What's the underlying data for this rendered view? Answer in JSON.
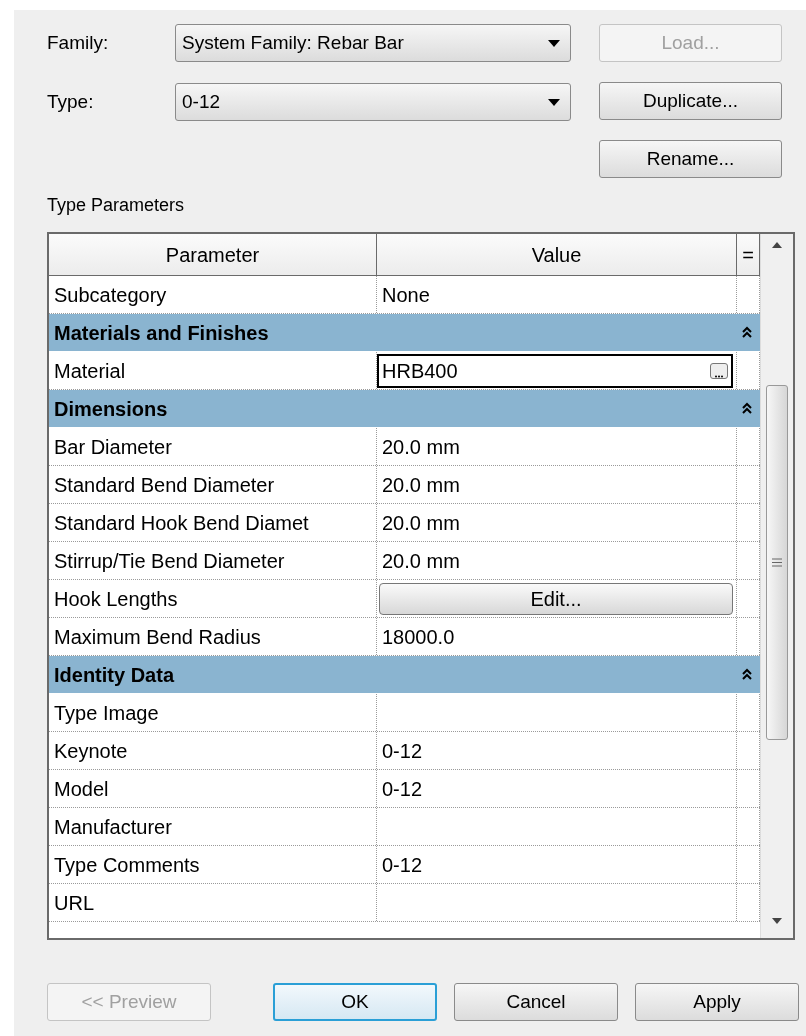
{
  "family": {
    "label": "Family:",
    "value": "System Family: Rebar Bar"
  },
  "type": {
    "label": "Type:",
    "value": "0-12"
  },
  "side_buttons": [
    {
      "label": "Load...",
      "disabled": true
    },
    {
      "label": "Duplicate...",
      "disabled": false
    },
    {
      "label": "Rename...",
      "disabled": false
    }
  ],
  "section_title": "Type Parameters",
  "table": {
    "columns": [
      "Parameter",
      "Value",
      "="
    ],
    "rows": [
      {
        "kind": "param",
        "name": "Subcategory",
        "value": "None"
      },
      {
        "kind": "group",
        "name": "Materials and Finishes",
        "expanded": true
      },
      {
        "kind": "field",
        "name": "Material",
        "value": "HRB400"
      },
      {
        "kind": "group",
        "name": "Dimensions",
        "expanded": true
      },
      {
        "kind": "param",
        "name": "Bar Diameter",
        "value": "20.0 mm"
      },
      {
        "kind": "param",
        "name": "Standard Bend Diameter",
        "value": "20.0 mm"
      },
      {
        "kind": "param",
        "name": "Standard Hook Bend Diamet",
        "value": "20.0 mm"
      },
      {
        "kind": "param",
        "name": "Stirrup/Tie Bend Diameter",
        "value": "20.0 mm"
      },
      {
        "kind": "button",
        "name": "Hook Lengths",
        "value": "Edit..."
      },
      {
        "kind": "param",
        "name": "Maximum Bend Radius",
        "value": "18000.0"
      },
      {
        "kind": "group",
        "name": "Identity Data",
        "expanded": true
      },
      {
        "kind": "param",
        "name": "Type Image",
        "value": ""
      },
      {
        "kind": "param",
        "name": "Keynote",
        "value": "0-12"
      },
      {
        "kind": "param",
        "name": "Model",
        "value": "0-12"
      },
      {
        "kind": "param",
        "name": "Manufacturer",
        "value": ""
      },
      {
        "kind": "param",
        "name": "Type Comments",
        "value": "0-12"
      },
      {
        "kind": "param",
        "name": "URL",
        "value": ""
      }
    ]
  },
  "footer_buttons": [
    {
      "label": "<< Preview",
      "disabled": true,
      "default": false
    },
    {
      "label": "OK",
      "disabled": false,
      "default": true
    },
    {
      "label": "Cancel",
      "disabled": false,
      "default": false
    },
    {
      "label": "Apply",
      "disabled": false,
      "default": false
    }
  ]
}
